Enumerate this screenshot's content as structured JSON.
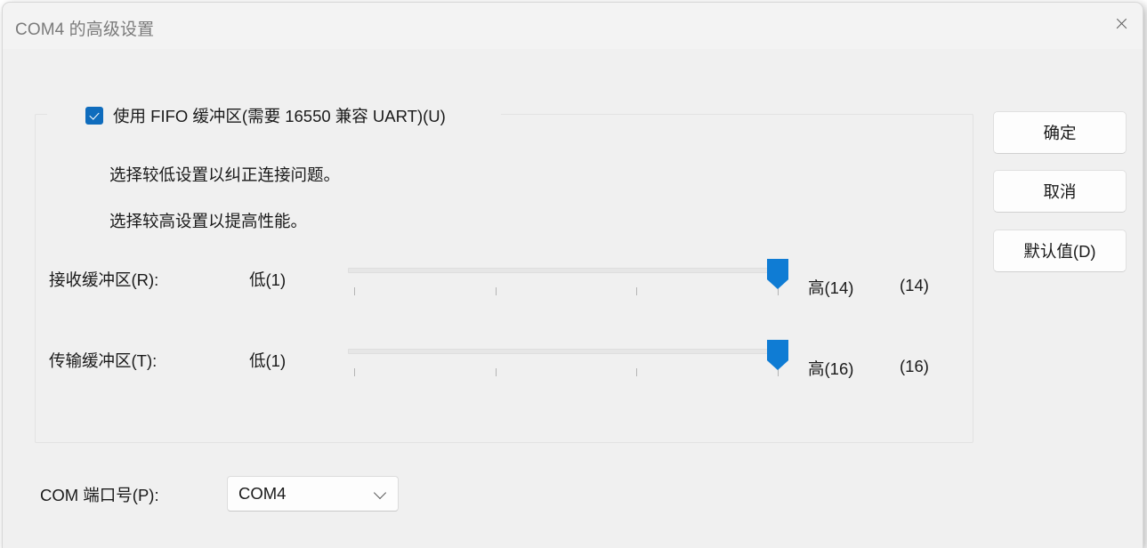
{
  "window": {
    "title": "COM4 的高级设置",
    "close_icon": "close-icon"
  },
  "fifo": {
    "checkbox_label": "使用 FIFO 缓冲区(需要 16550 兼容 UART)(U)",
    "checked": true,
    "description_line_1": "选择较低设置以纠正连接问题。",
    "description_line_2": "选择较高设置以提高性能。"
  },
  "sliders": [
    {
      "name": "receive-buffer",
      "label": "接收缓冲区(R):",
      "low_label": "低(1)",
      "high_label": "高(14)",
      "value_label": "(14)",
      "min": 1,
      "max": 14,
      "value": 14,
      "tick_count": 4
    },
    {
      "name": "transmit-buffer",
      "label": "传输缓冲区(T):",
      "low_label": "低(1)",
      "high_label": "高(16)",
      "value_label": "(16)",
      "min": 1,
      "max": 16,
      "value": 16,
      "tick_count": 4
    }
  ],
  "buttons": {
    "ok": "确定",
    "cancel": "取消",
    "defaults": "默认值(D)"
  },
  "com_port": {
    "label": "COM 端口号(P):",
    "selected": "COM4",
    "chevron_icon": "chevron-down-icon"
  },
  "colors": {
    "accent": "#0f7cd4",
    "checkbox_fill": "#0f6cbd",
    "window_body": "#f0f0f0",
    "titlebar": "#f3f3f3",
    "text": "#1a1a1a",
    "title_text": "#7b7b7b"
  }
}
